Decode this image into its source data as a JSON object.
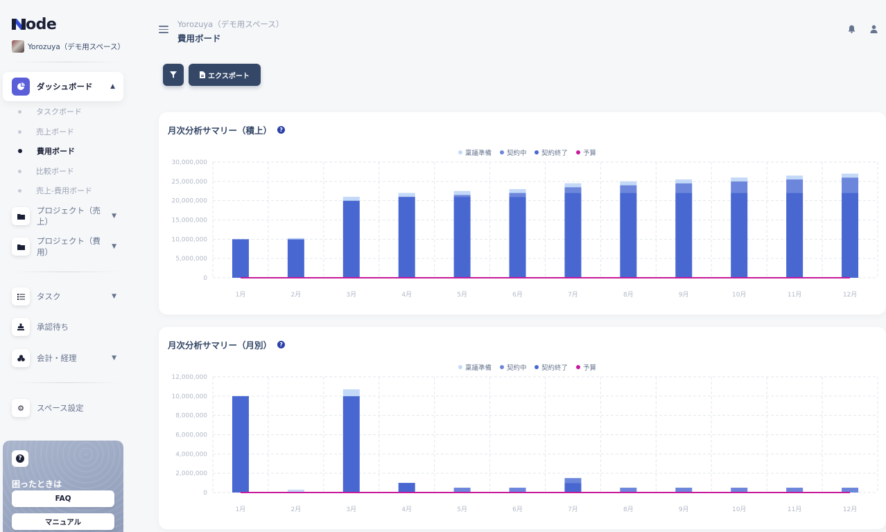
{
  "app": {
    "logo_text": "ode",
    "workspace_name": "Yorozuya（デモ用スペース）"
  },
  "sidebar": {
    "dashboard": {
      "label": "ダッシュボード"
    },
    "sub_items": [
      {
        "label": "タスクボード",
        "active": false
      },
      {
        "label": "売上ボード",
        "active": false
      },
      {
        "label": "費用ボード",
        "active": true
      },
      {
        "label": "比較ボード",
        "active": false
      },
      {
        "label": "売上-費用ボード",
        "active": false
      }
    ],
    "projects_sales": {
      "label": "プロジェクト（売上）"
    },
    "projects_cost": {
      "label": "プロジェクト（費用）"
    },
    "tasks": {
      "label": "タスク"
    },
    "approvals": {
      "label": "承認待ち"
    },
    "accounting": {
      "label": "会計・経理"
    },
    "space_settings": {
      "label": "スペース設定"
    },
    "help": {
      "title": "困ったときは",
      "faq_label": "FAQ",
      "manual_label": "マニュアル"
    }
  },
  "header": {
    "breadcrumb": "Yorozuya（デモ用スペース）",
    "title": "費用ボード",
    "icons": [
      "bell-icon",
      "user-icon"
    ]
  },
  "toolbar": {
    "export_label": "エクスポート",
    "filter_icon": "filter-icon"
  },
  "colors": {
    "proposal": "#c3d9f7",
    "contracting": "#6c86dc",
    "contracted": "#4867d1",
    "budget": "#c8189b",
    "accent": "#5a5fd8",
    "dark_button": "#344767"
  },
  "chart_data": [
    {
      "type": "bar",
      "title": "月次分析サマリー（積上）",
      "stacked": true,
      "categories": [
        "1月",
        "2月",
        "3月",
        "4月",
        "5月",
        "6月",
        "7月",
        "8月",
        "9月",
        "10月",
        "11月",
        "12月"
      ],
      "series": [
        {
          "name": "契約終了",
          "values": [
            10000000,
            10000000,
            20000000,
            21000000,
            21000000,
            21000000,
            22000000,
            22000000,
            22000000,
            22000000,
            22000000,
            22000000
          ]
        },
        {
          "name": "契約中",
          "values": [
            0,
            0,
            0,
            0,
            500000,
            1000000,
            1500000,
            2000000,
            2500000,
            3000000,
            3500000,
            4000000
          ]
        },
        {
          "name": "稟議準備",
          "values": [
            0,
            300000,
            1000000,
            1000000,
            1000000,
            1000000,
            1000000,
            1000000,
            1000000,
            1000000,
            1000000,
            1000000
          ]
        },
        {
          "name": "予算",
          "type": "line",
          "values": [
            0,
            0,
            0,
            0,
            0,
            0,
            0,
            0,
            0,
            0,
            0,
            0
          ]
        }
      ],
      "ylim": [
        0,
        30000000
      ],
      "yticks": [
        "30,000,000",
        "25,000,000",
        "20,000,000",
        "15,000,000",
        "10,000,000",
        "5,000,000",
        "0"
      ],
      "legend_order": [
        "稟議準備",
        "契約中",
        "契約終了",
        "予算"
      ],
      "legend": "top-center",
      "grid": true
    },
    {
      "type": "bar",
      "title": "月次分析サマリー（月別）",
      "stacked": true,
      "categories": [
        "1月",
        "2月",
        "3月",
        "4月",
        "5月",
        "6月",
        "7月",
        "8月",
        "9月",
        "10月",
        "11月",
        "12月"
      ],
      "series": [
        {
          "name": "契約終了",
          "values": [
            10000000,
            0,
            10000000,
            1000000,
            0,
            0,
            1000000,
            0,
            0,
            0,
            0,
            0
          ]
        },
        {
          "name": "契約中",
          "values": [
            0,
            0,
            0,
            0,
            500000,
            500000,
            500000,
            500000,
            500000,
            500000,
            500000,
            500000
          ]
        },
        {
          "name": "稟議準備",
          "values": [
            0,
            300000,
            700000,
            0,
            0,
            0,
            0,
            0,
            0,
            0,
            0,
            0
          ]
        },
        {
          "name": "予算",
          "type": "line",
          "values": [
            0,
            0,
            0,
            0,
            0,
            0,
            0,
            0,
            0,
            0,
            0,
            0
          ]
        }
      ],
      "ylim": [
        0,
        12000000
      ],
      "yticks": [
        "12,000,000",
        "10,000,000",
        "8,000,000",
        "6,000,000",
        "4,000,000",
        "2,000,000",
        "0"
      ],
      "legend_order": [
        "稟議準備",
        "契約中",
        "契約終了",
        "予算"
      ],
      "legend": "top-center",
      "grid": true
    }
  ]
}
